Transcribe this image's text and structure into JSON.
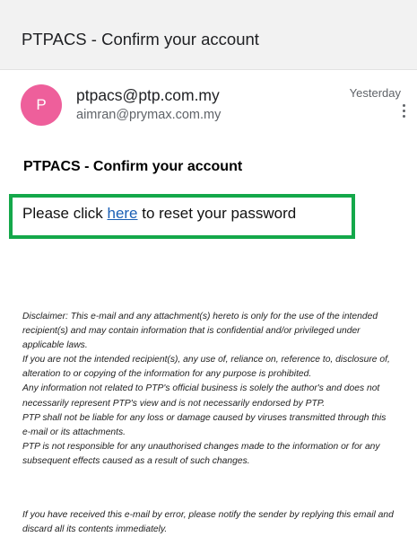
{
  "subject_bar": {
    "title": "PTPACS - Confirm your account"
  },
  "message": {
    "avatar_letter": "P",
    "avatar_color": "#ee5f9b",
    "sender": "ptpacs@ptp.com.my",
    "recipient": "aimran@prymax.com.my",
    "date": "Yesterday",
    "heading": "PTPACS - Confirm your account",
    "reset": {
      "prefix": "Please click ",
      "link_text": "here",
      "suffix": " to reset your password"
    },
    "highlight_color": "#14a84a",
    "disclaimer_lines": [
      "Disclaimer: This e-mail and any attachment(s) hereto is only for the use of the intended",
      "recipient(s) and may contain information that is confidential and/or privileged under",
      "applicable laws.",
      "If you are not the intended recipient(s), any use of, reliance on, reference to, disclosure of,",
      "alteration to or copying of the information for any purpose is prohibited.",
      "Any information not related to PTP's official business is solely the author's and does not",
      "necessarily represent PTP's view and is not necessarily endorsed by PTP.",
      "PTP shall not be liable for any loss or damage caused by viruses transmitted through this",
      "e-mail or its attachments.",
      "PTP is not responsible for any unauthorised changes made to the information or for any",
      "subsequent effects caused as a result of such changes."
    ],
    "error_note_lines": [
      "If you have received this e-mail by error, please notify the sender by replying this email and",
      "discard all its contents immediately."
    ]
  }
}
